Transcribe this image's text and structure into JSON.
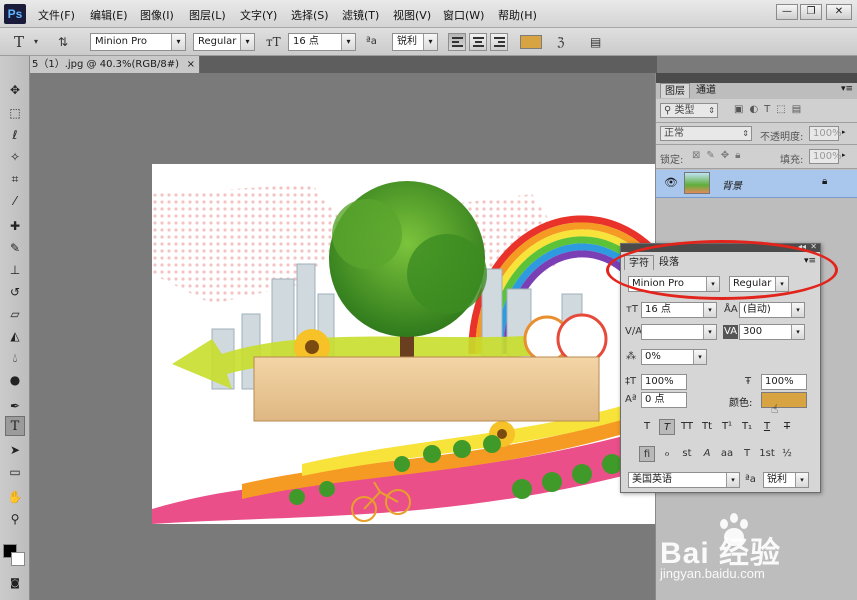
{
  "app": {
    "logo": "Ps"
  },
  "menu": [
    "文件(F)",
    "编辑(E)",
    "图像(I)",
    "图层(L)",
    "文字(Y)",
    "选择(S)",
    "滤镜(T)",
    "视图(V)",
    "窗口(W)",
    "帮助(H)"
  ],
  "window_controls": {
    "minimize": "—",
    "restore": "❐",
    "close": "✕"
  },
  "options": {
    "tool_icon": "T",
    "font_family": "Minion Pro",
    "font_style": "Regular",
    "font_size": "16 点",
    "aa_icon": "ªa",
    "antialias": "锐利",
    "color_hex": "#d8a442"
  },
  "document_tab": {
    "title": "5（1）.jpg @ 40.3%(RGB/8#)",
    "close": "×"
  },
  "layers_panel": {
    "tabs": [
      "图层",
      "通道"
    ],
    "filter_kind": "类型",
    "blend_mode": "正常",
    "opacity_label": "不透明度:",
    "opacity_value": "100%",
    "lock_label": "锁定:",
    "fill_label": "填充:",
    "fill_value": "100%",
    "layer_name": "背景"
  },
  "character_panel": {
    "tabs": [
      "字符",
      "段落"
    ],
    "font_family": "Minion Pro",
    "font_style": "Regular",
    "font_size": "16 点",
    "leading": "(自动)",
    "kerning": "",
    "tracking": "300",
    "baseline_scale": "0%",
    "vertical_scale": "100%",
    "horizontal_scale": "100%",
    "baseline_shift": "0 点",
    "color_label": "颜色:",
    "color_hex": "#d8a442",
    "style_buttons": [
      "T",
      "T",
      "TT",
      "Tt",
      "T¹",
      "T₁",
      "T",
      "T"
    ],
    "opentype_buttons": [
      "fi",
      "ℴ",
      "st",
      "A",
      "aa",
      "T",
      "1st",
      "½"
    ],
    "language": "美国英语",
    "aa_icon": "ªa",
    "antialias": "锐利"
  },
  "watermark": {
    "logo": "Bai 经验",
    "url": "jingyan.baidu.com"
  }
}
